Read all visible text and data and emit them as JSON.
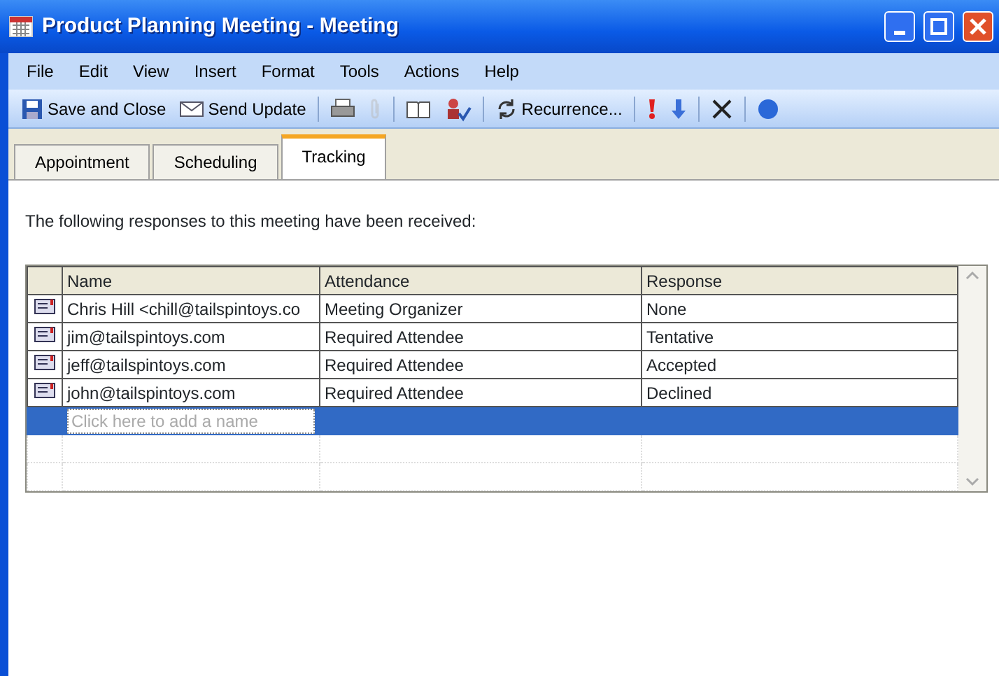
{
  "window": {
    "title": "Product Planning Meeting - Meeting"
  },
  "menu": [
    "File",
    "Edit",
    "View",
    "Insert",
    "Format",
    "Tools",
    "Actions",
    "Help"
  ],
  "toolbar": [
    {
      "kind": "text",
      "label": "Save and Close",
      "disabled": false
    },
    {
      "kind": "text",
      "label": "Send Update",
      "disabled": false
    },
    {
      "kind": "icon",
      "disabled": false
    },
    {
      "kind": "icon",
      "disabled": true
    },
    {
      "kind": "icon",
      "disabled": false
    },
    {
      "kind": "icon",
      "disabled": false
    },
    {
      "kind": "text",
      "label": "Recurrence...",
      "disabled": false
    },
    {
      "kind": "icon",
      "disabled": false
    },
    {
      "kind": "icon",
      "disabled": false
    },
    {
      "kind": "icon",
      "disabled": false
    },
    {
      "kind": "icon",
      "disabled": false
    }
  ],
  "tabs": [
    {
      "label": "Appointment",
      "selected": false
    },
    {
      "label": "Scheduling",
      "selected": false
    },
    {
      "label": "Tracking",
      "selected": true
    }
  ],
  "intro": "The following responses to this meeting have been received:",
  "table": {
    "columns": [
      "Name",
      "Attendance",
      "Response"
    ],
    "rows": [
      {
        "name": "Chris Hill <chill@tailspintoys.co",
        "attendance": "Meeting Organizer",
        "response": "None",
        "selected": false
      },
      {
        "name": "jim@tailspintoys.com",
        "attendance": "Required Attendee",
        "response": "Tentative",
        "selected": false
      },
      {
        "name": "jeff@tailspintoys.com",
        "attendance": "Required Attendee",
        "response": "Accepted",
        "selected": false
      },
      {
        "name": "john@tailspintoys.com",
        "attendance": "Required Attendee",
        "response": "Declined",
        "selected": false
      }
    ],
    "new_row": {
      "placeholder": "Click here to add a name",
      "selected": true
    }
  }
}
